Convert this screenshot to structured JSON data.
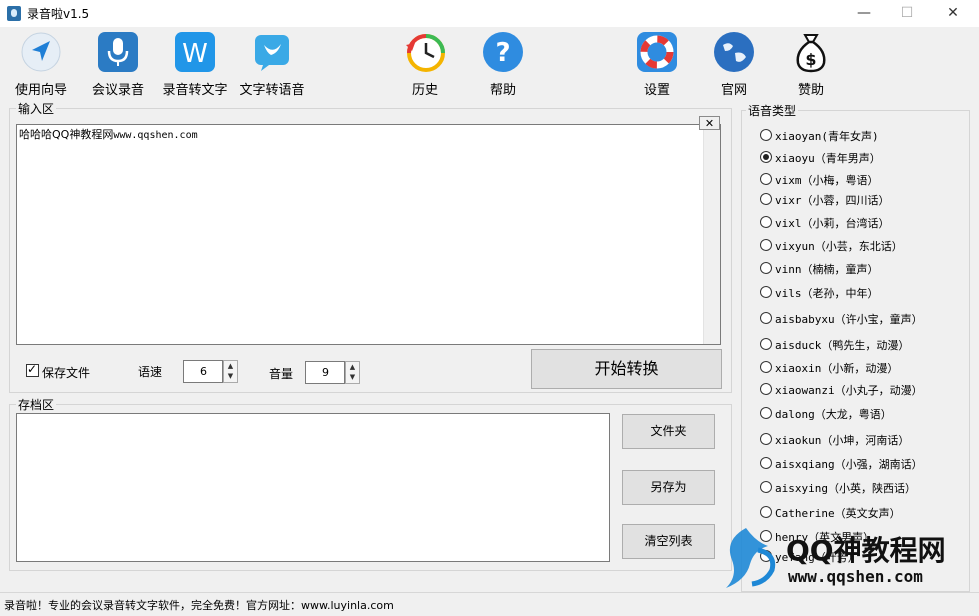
{
  "window": {
    "title": "录音啦v1.5",
    "minimize": "—",
    "maximize": "☐",
    "close": "✕"
  },
  "toolbar": {
    "guide": "使用向导",
    "meeting": "会议录音",
    "speech_to_text": "录音转文字",
    "text_to_speech": "文字转语音",
    "history": "历史",
    "help": "帮助",
    "settings": "设置",
    "website": "官网",
    "donate": "赞助",
    "icon_colors": {
      "blue": "#2e8fd8",
      "red": "#e53935",
      "green": "#3cba54"
    }
  },
  "input_section": {
    "title": "输入区",
    "text_prefix": "哈哈哈QQ神教程网",
    "text_url": "www.qqshen.com",
    "clear_button": "✕"
  },
  "controls": {
    "save_file_label": "保存文件",
    "save_file_checked": true,
    "speed_label": "语速",
    "speed_value": "6",
    "volume_label": "音量",
    "volume_value": "9",
    "convert_button": "开始转换"
  },
  "archive_section": {
    "title": "存档区",
    "folder_button": "文件夹",
    "save_as_button": "另存为",
    "clear_list_button": "清空列表"
  },
  "voice_types": {
    "title": "语音类型",
    "selected_index": 1,
    "items": [
      "xiaoyan(青年女声)",
      "xiaoyu（青年男声）",
      "vixm（小梅，粤语）",
      "vixr（小蓉，四川话）",
      "vixl（小莉，台湾话）",
      "vixyun（小芸，东北话）",
      "vinn（楠楠，童声）",
      "vils（老孙，中年）",
      "aisbabyxu（许小宝，童声）",
      "aisduck（鸭先生，动漫）",
      "xiaoxin（小新，动漫）",
      "xiaowanzi（小丸子，动漫）",
      "dalong（大龙，粤语）",
      "xiaokun（小坤，河南话）",
      "aisxqiang（小强，湖南话）",
      "aisxying（小英，陕西话）",
      "Catherine（英文女声）",
      "henry（英文男声）",
      "yefang（叶芳）"
    ]
  },
  "status": {
    "text": "录音啦！专业的会议录音转文字软件，完全免费！官方网址：www.luyinla.com"
  },
  "watermark": {
    "brand": "QQ神教程网",
    "url": "www.qqshen.com"
  }
}
